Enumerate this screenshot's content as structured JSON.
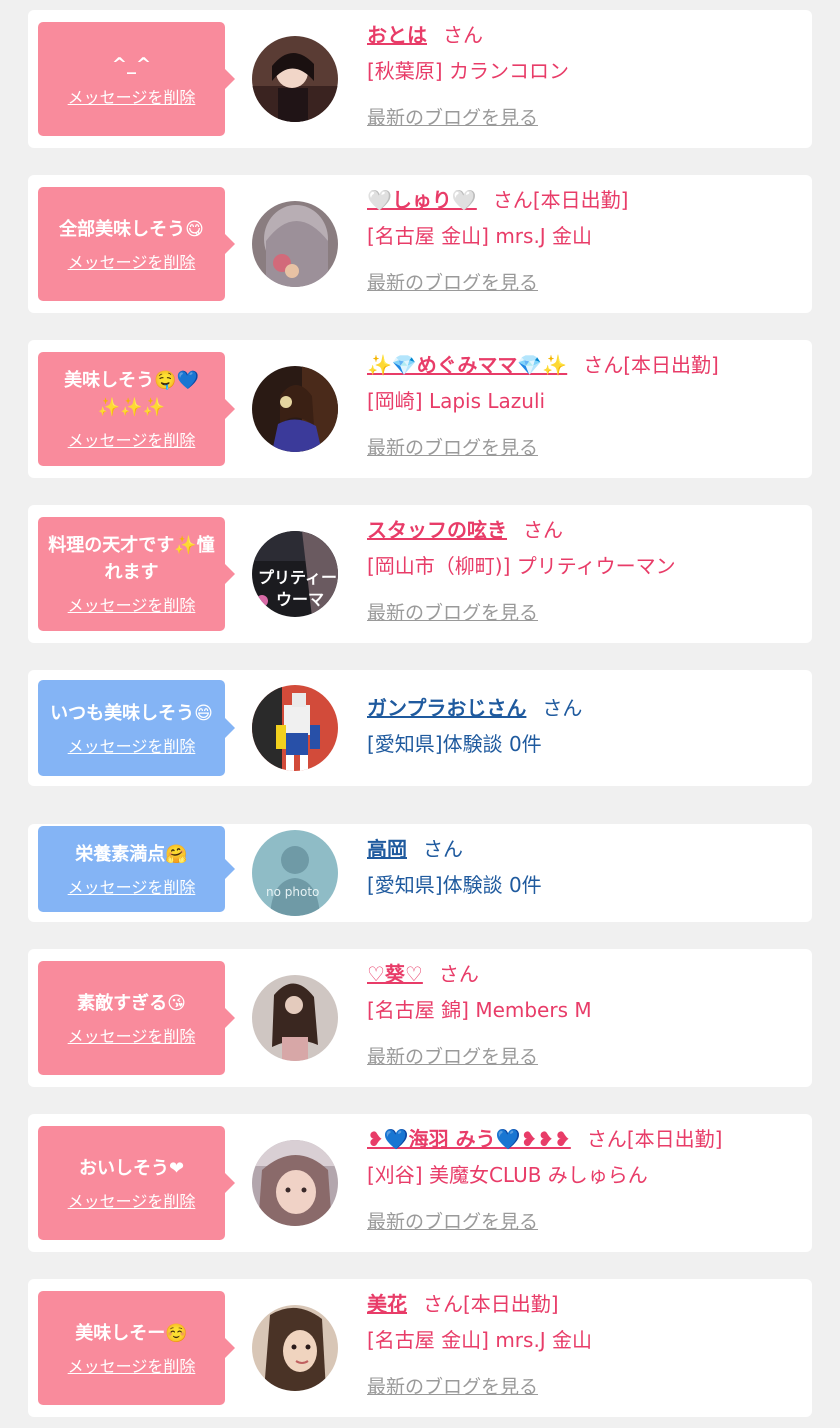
{
  "delete_label": "メッセージを削除",
  "blog_label": "最新のブログを見る",
  "honorific": "さん",
  "colors": {
    "pink_bubble": "#f98b9c",
    "blue_bubble": "#84b4f5",
    "pink_text": "#e83c68",
    "blue_text": "#1f5a9e",
    "link_gray": "#9a9a9a",
    "background": "#f0f0f0"
  },
  "items": [
    {
      "message": "^_^",
      "name": "おとは",
      "status": "",
      "shop": "[秋葉原] カランコロン",
      "type": "girl",
      "avatar_icon": "girl-photo"
    },
    {
      "message": "全部美味しそう😋",
      "name": "🤍しゅり🤍",
      "status": "[本日出勤]",
      "shop": "[名古屋 金山] mrs.J 金山",
      "type": "girl",
      "avatar_icon": "girl-photo"
    },
    {
      "message": "美味しそう🤤💙✨✨✨",
      "name": "✨💎めぐみママ💎✨",
      "status": "[本日出勤]",
      "shop": "[岡崎] Lapis Lazuli",
      "type": "girl",
      "avatar_icon": "girl-photo"
    },
    {
      "message": "料理の天才です✨憧れます",
      "name": "スタッフの呟き",
      "status": "",
      "shop": "[岡山市（柳町)] プリティウーマン",
      "type": "girl",
      "avatar_icon": "shop-logo"
    },
    {
      "message": "いつも美味しそう😄",
      "name": "ガンプラおじさん",
      "status": "",
      "shop": "[愛知県]体験談 0件",
      "type": "user",
      "avatar_icon": "robot-photo"
    },
    {
      "message": "栄養素満点🤗",
      "name": "高岡",
      "status": "",
      "shop": "[愛知県]体験談 0件",
      "type": "user",
      "avatar_icon": "no-photo-silhouette",
      "avatar_text": "no photo"
    },
    {
      "message": "素敵すぎる😘",
      "name": "♡葵♡",
      "status": "",
      "shop": "[名古屋 錦] Members M",
      "type": "girl",
      "avatar_icon": "girl-photo"
    },
    {
      "message": "おいしそう❤",
      "name": "❥💙海羽 みう💙❥❥❥",
      "status": "[本日出勤]",
      "shop": "[刈谷] 美魔女CLUB みしゅらん",
      "type": "girl",
      "avatar_icon": "girl-photo"
    },
    {
      "message": "美味しそー☺️",
      "name": "美花",
      "status": "[本日出勤]",
      "shop": "[名古屋 金山] mrs.J 金山",
      "type": "girl",
      "avatar_icon": "girl-photo"
    }
  ]
}
